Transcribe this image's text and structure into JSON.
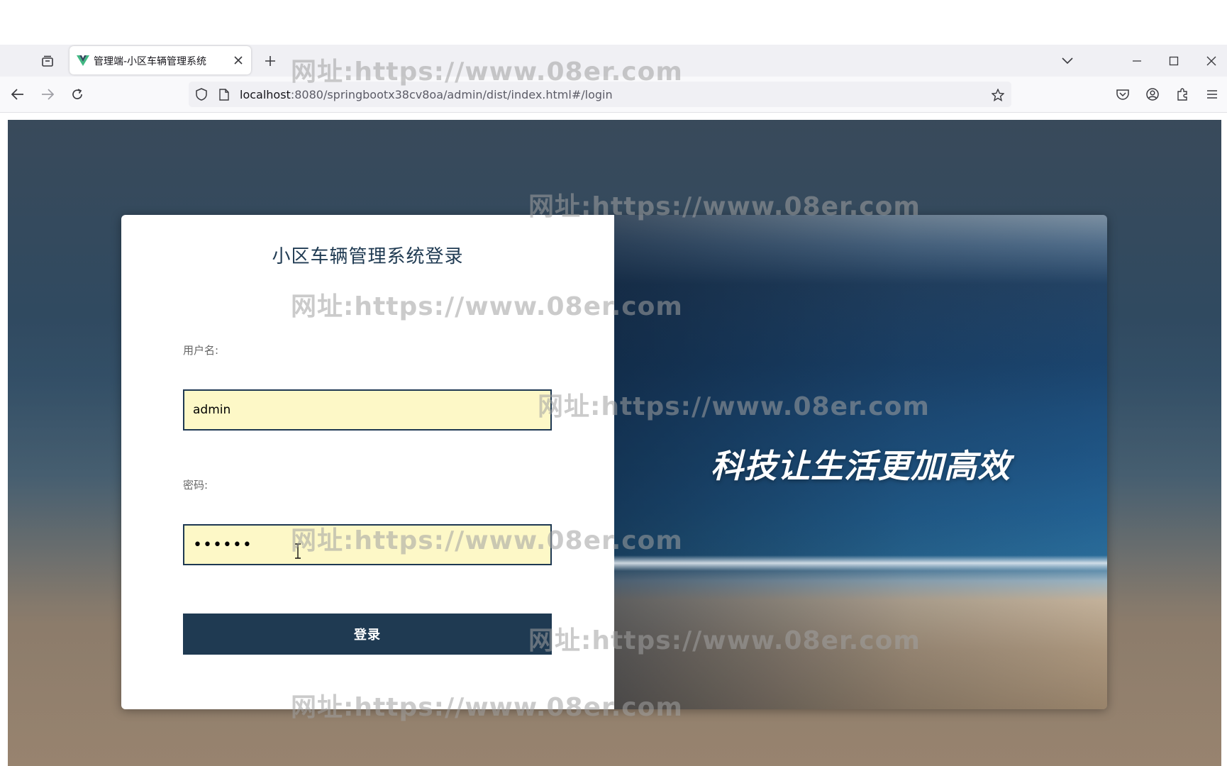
{
  "browser": {
    "tab_title": "管理端-小区车辆管理系统",
    "url_host": "localhost",
    "url_path": ":8080/springbootx38cv8oa/admin/dist/index.html#/login"
  },
  "login": {
    "title": "小区车辆管理系统登录",
    "username_label": "用户名:",
    "username_value": "admin",
    "password_label": "密码:",
    "password_value": "••••••",
    "submit_label": "登录"
  },
  "banner": {
    "slogan": "科技让生活更加高效"
  },
  "watermark": {
    "text": "网址:https://www.08er.com"
  },
  "colors": {
    "primary": "#1f3a52",
    "input_background": "#fdf8c7"
  },
  "icons": {
    "tab_manager": "tab-manager-icon",
    "favicon": "vue-logo-icon",
    "close": "close-icon",
    "new_tab": "plus-icon",
    "list_tabs": "chevron-down-icon",
    "minimize": "minimize-icon",
    "maximize": "maximize-icon",
    "window_close": "window-close-icon",
    "back": "back-arrow-icon",
    "forward": "forward-arrow-icon",
    "reload": "reload-icon",
    "shield": "shield-icon",
    "page": "page-icon",
    "bookmark": "star-icon",
    "pocket": "pocket-icon",
    "account": "account-icon",
    "extensions": "puzzle-icon",
    "menu": "hamburger-menu-icon"
  }
}
